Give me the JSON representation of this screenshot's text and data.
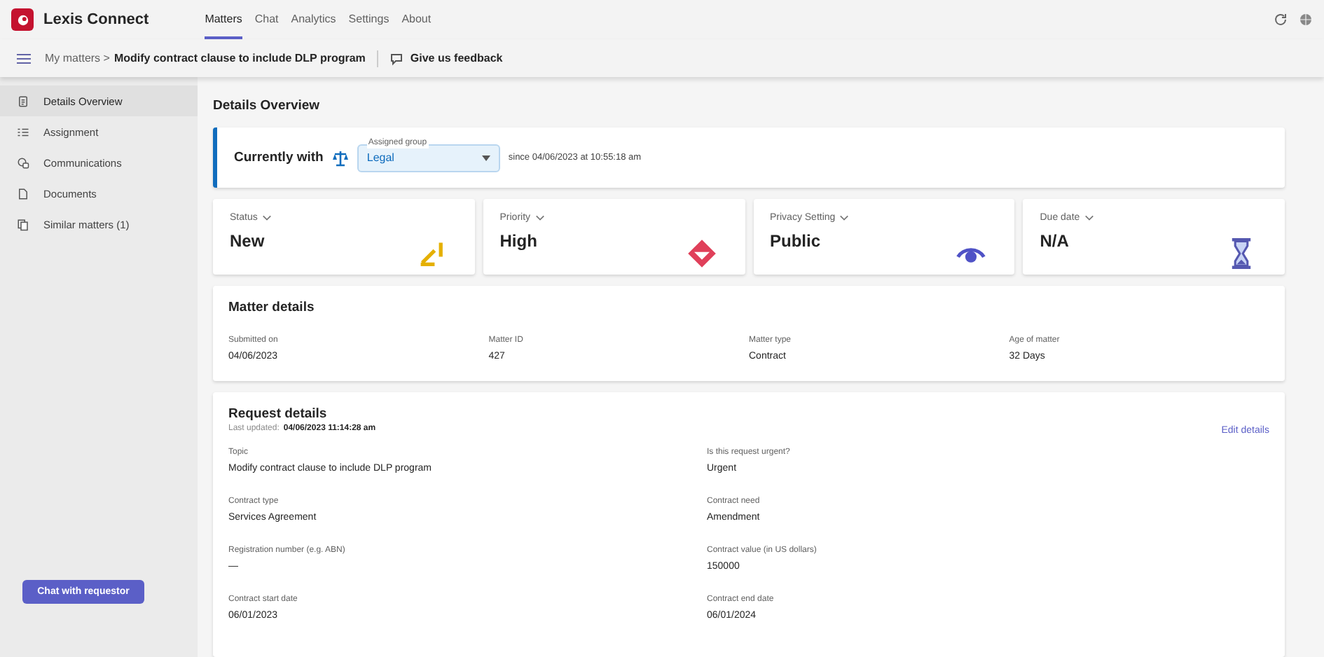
{
  "app": {
    "title": "Lexis Connect"
  },
  "tabs": [
    {
      "label": "Matters",
      "selected": true
    },
    {
      "label": "Chat",
      "selected": false
    },
    {
      "label": "Analytics",
      "selected": false
    },
    {
      "label": "Settings",
      "selected": false
    },
    {
      "label": "About",
      "selected": false
    }
  ],
  "breadcrumb": {
    "parent": "My matters",
    "separator": ">",
    "current": "Modify contract clause to include DLP program",
    "feedback": "Give us feedback"
  },
  "sidebar": {
    "items": [
      {
        "label": "Details Overview",
        "kind": "doc",
        "selected": true
      },
      {
        "label": "Assignment",
        "kind": "list",
        "selected": false
      },
      {
        "label": "Communications",
        "kind": "chat",
        "selected": false
      },
      {
        "label": "Documents",
        "kind": "page",
        "selected": false
      },
      {
        "label": "Similar matters (1)",
        "kind": "copy",
        "selected": false
      }
    ],
    "button": "Chat with requestor"
  },
  "page_title": "Details Overview",
  "currently_with": {
    "label": "Currently with",
    "field_label": "Assigned group",
    "value": "Legal",
    "since": "since 04/06/2023 at 10:55:18 am"
  },
  "metrics": [
    {
      "label": "Status",
      "value": "New",
      "kind": "status"
    },
    {
      "label": "Priority",
      "value": "High",
      "kind": "priority"
    },
    {
      "label": "Privacy Setting",
      "value": "Public",
      "kind": "privacy"
    },
    {
      "label": "Due date",
      "value": "N/A",
      "kind": "due"
    }
  ],
  "matter_details": {
    "title": "Matter details",
    "fields": [
      {
        "label": "Submitted on",
        "value": "04/06/2023"
      },
      {
        "label": "Matter ID",
        "value": "427"
      },
      {
        "label": "Matter type",
        "value": "Contract"
      },
      {
        "label": "Age of matter",
        "value": "32 Days"
      }
    ]
  },
  "request_details": {
    "title": "Request details",
    "updated_label": "Last updated:",
    "updated_value": "04/06/2023 11:14:28 am",
    "edit": "Edit details",
    "fields": [
      {
        "label": "Topic",
        "value": "Modify contract clause to include DLP program"
      },
      {
        "label": "Is this request urgent?",
        "value": "Urgent"
      },
      {
        "label": "Contract type",
        "value": "Services Agreement"
      },
      {
        "label": "Contract need",
        "value": "Amendment"
      },
      {
        "label": "Registration number (e.g. ABN)",
        "value": "—"
      },
      {
        "label": "Contract value (in US dollars)",
        "value": "150000"
      },
      {
        "label": "Contract start date",
        "value": "06/01/2023"
      },
      {
        "label": "Contract end date",
        "value": "06/01/2024"
      }
    ]
  }
}
